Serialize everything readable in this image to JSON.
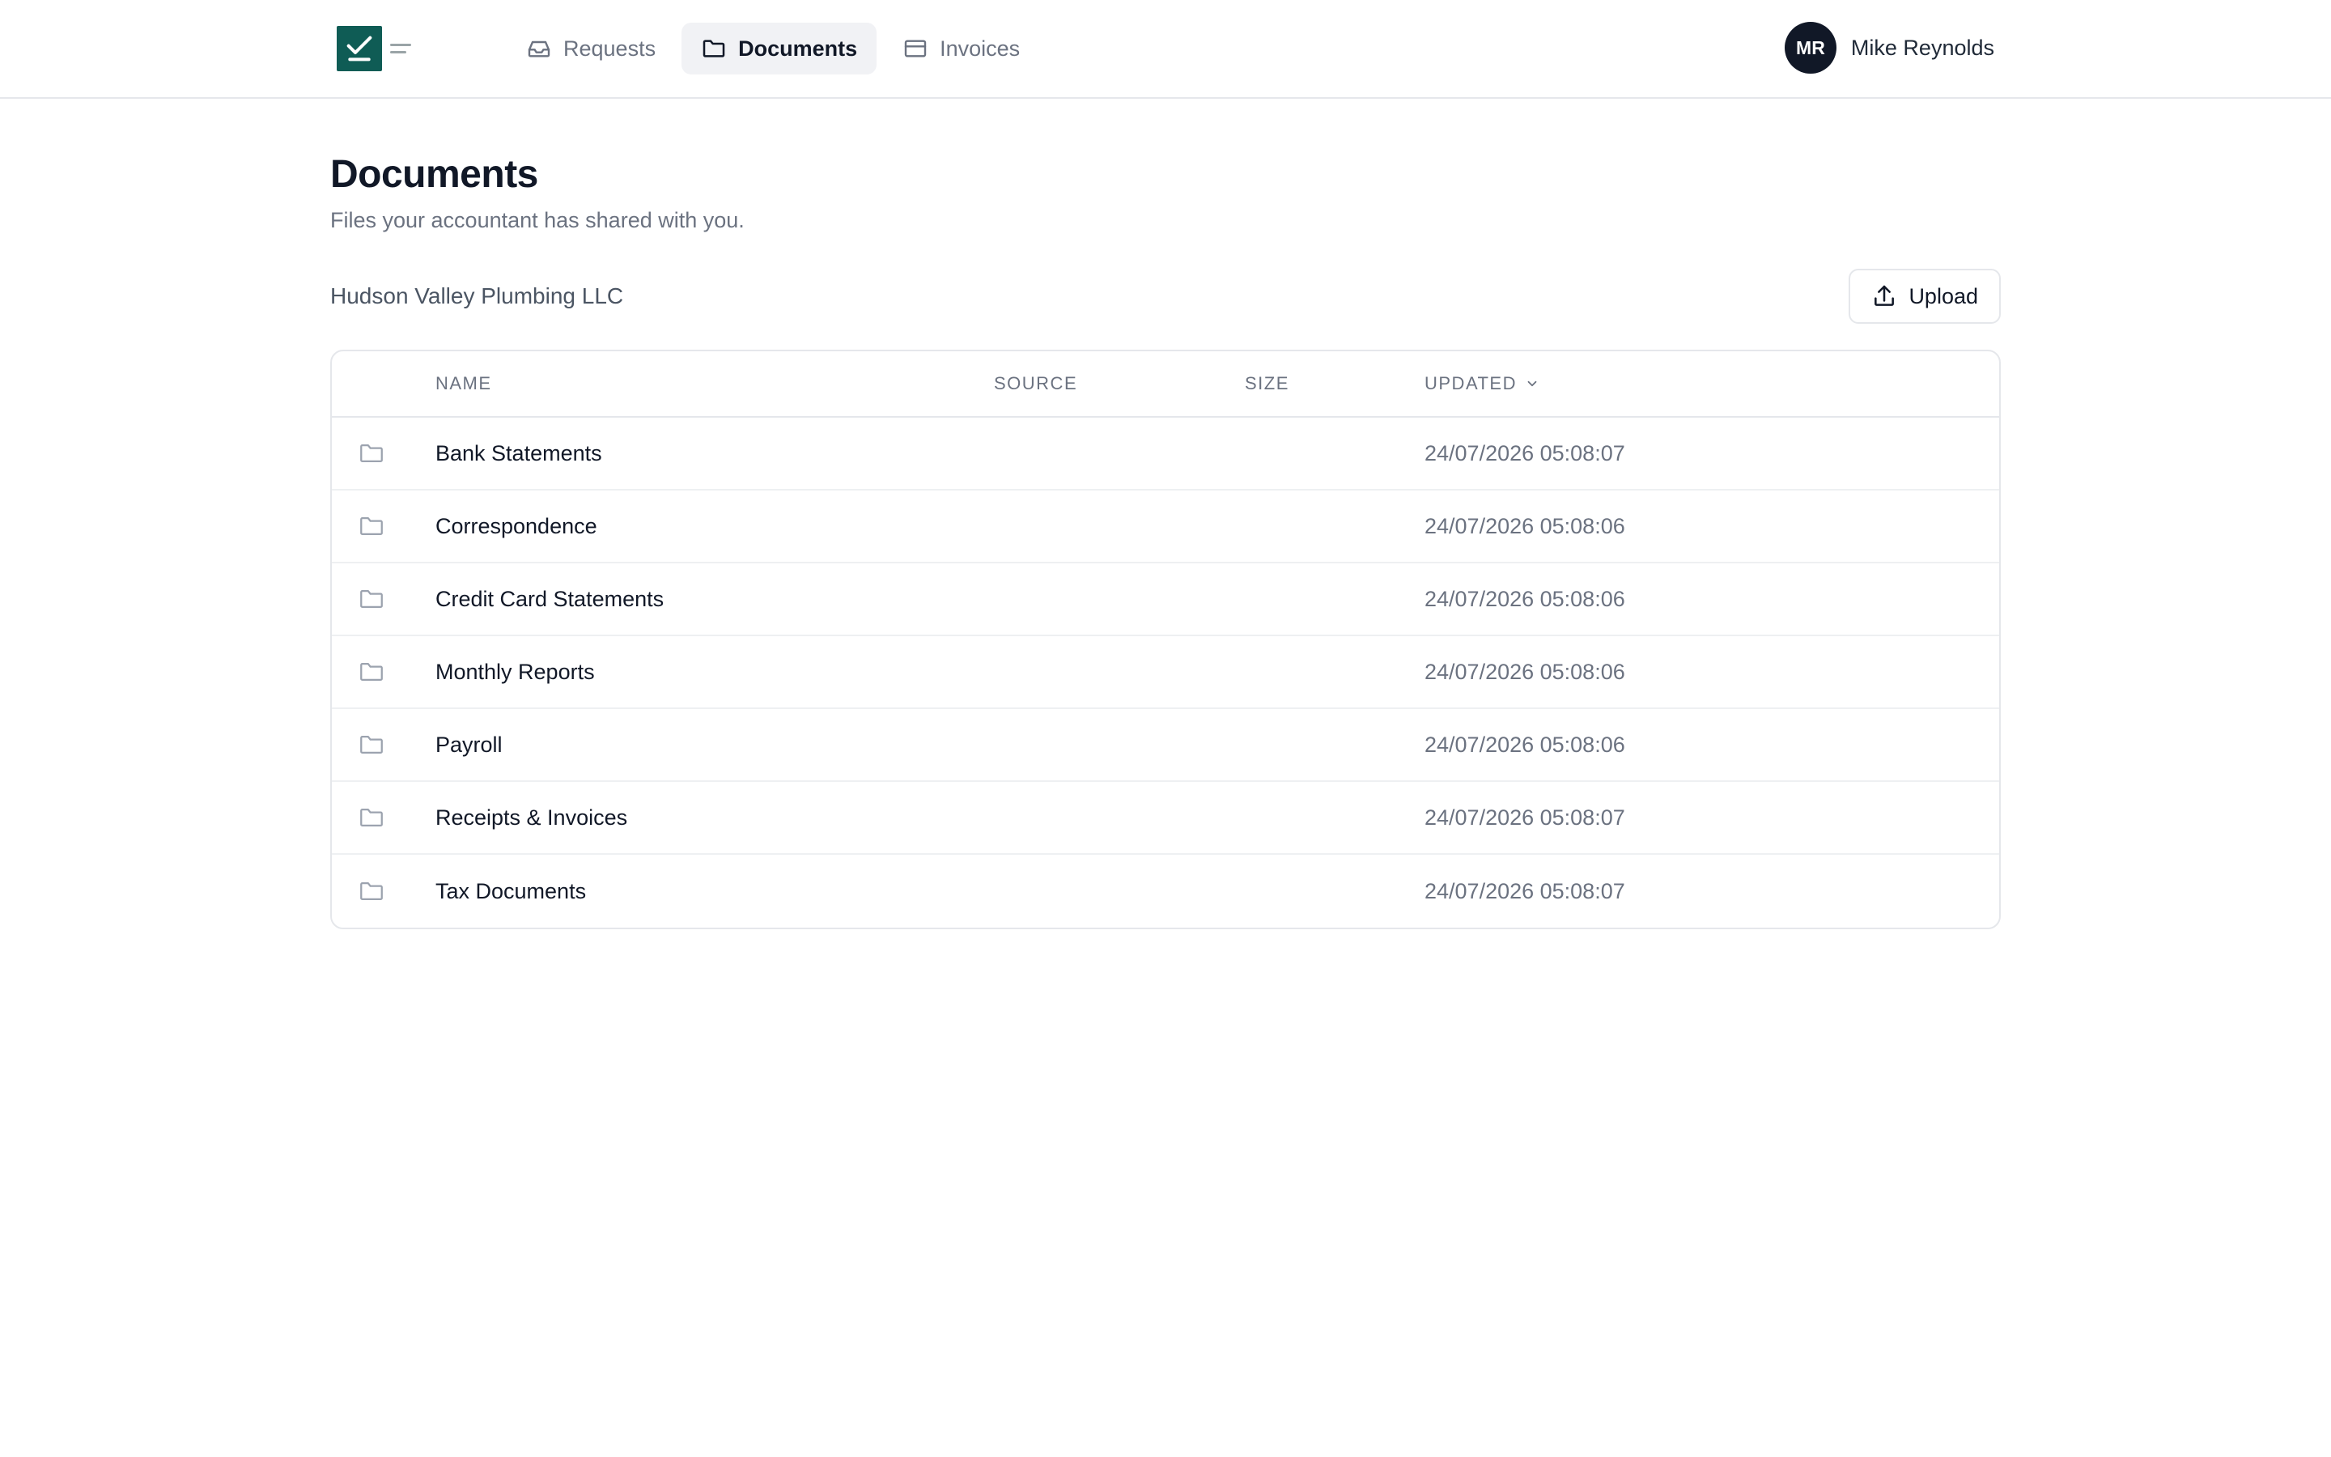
{
  "colors": {
    "brand": "#0f5c55",
    "avatar_bg": "#111827",
    "active_nav_bg": "#f1f2f5",
    "border": "#e5e7eb",
    "muted_text": "#6b7280"
  },
  "nav": {
    "items": [
      {
        "label": "Requests",
        "icon": "inbox-icon",
        "active": false
      },
      {
        "label": "Documents",
        "icon": "folder-icon",
        "active": true
      },
      {
        "label": "Invoices",
        "icon": "credit-card-icon",
        "active": false
      }
    ]
  },
  "user": {
    "initials": "MR",
    "name": "Mike Reynolds"
  },
  "page": {
    "title": "Documents",
    "subtitle": "Files your accountant has shared with you."
  },
  "toolbar": {
    "client_name": "Hudson Valley Plumbing LLC",
    "upload_label": "Upload",
    "upload_icon": "upload-icon"
  },
  "table": {
    "headers": {
      "name": "NAME",
      "source": "SOURCE",
      "size": "SIZE",
      "updated": "UPDATED"
    },
    "sort_icon": "chevron-down-icon",
    "rows": [
      {
        "icon": "folder-icon",
        "name": "Bank Statements",
        "source": "",
        "size": "",
        "updated": "24/07/2026 05:08:07"
      },
      {
        "icon": "folder-icon",
        "name": "Correspondence",
        "source": "",
        "size": "",
        "updated": "24/07/2026 05:08:06"
      },
      {
        "icon": "folder-icon",
        "name": "Credit Card Statements",
        "source": "",
        "size": "",
        "updated": "24/07/2026 05:08:06"
      },
      {
        "icon": "folder-icon",
        "name": "Monthly Reports",
        "source": "",
        "size": "",
        "updated": "24/07/2026 05:08:06"
      },
      {
        "icon": "folder-icon",
        "name": "Payroll",
        "source": "",
        "size": "",
        "updated": "24/07/2026 05:08:06"
      },
      {
        "icon": "folder-icon",
        "name": "Receipts & Invoices",
        "source": "",
        "size": "",
        "updated": "24/07/2026 05:08:07"
      },
      {
        "icon": "folder-icon",
        "name": "Tax Documents",
        "source": "",
        "size": "",
        "updated": "24/07/2026 05:08:07"
      }
    ]
  }
}
